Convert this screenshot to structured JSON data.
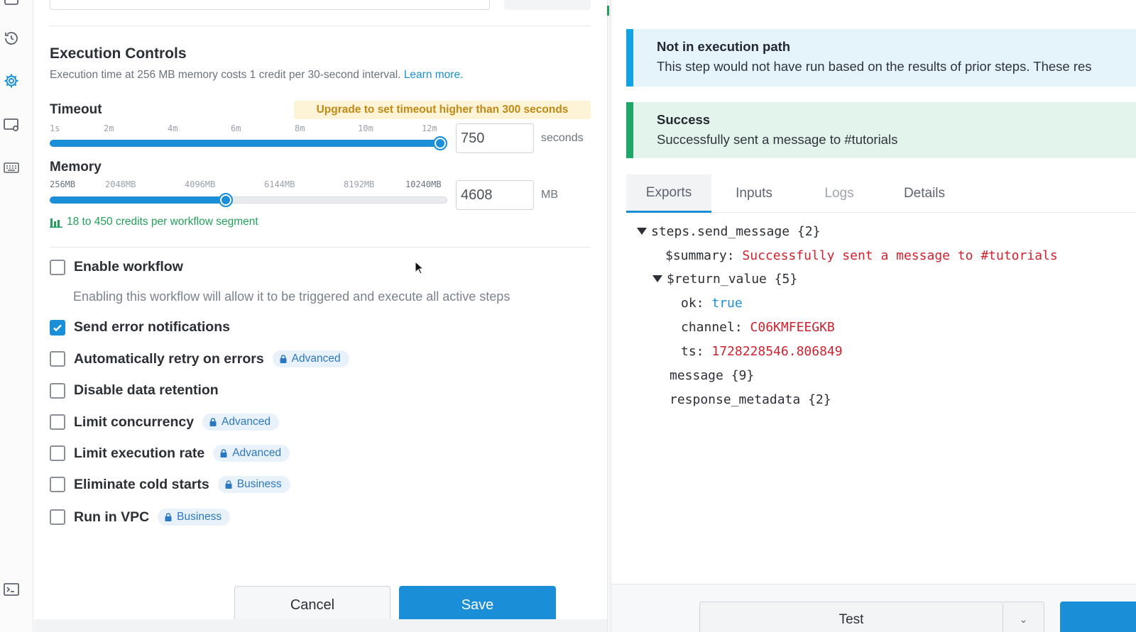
{
  "settings": {
    "section_title": "Execution Controls",
    "section_desc": "Execution time at 256 MB memory costs 1 credit per 30-second interval.",
    "learn_more": "Learn more.",
    "timeout": {
      "label": "Timeout",
      "upgrade_notice": "Upgrade to set timeout higher than 300 seconds",
      "ticks": [
        "1s",
        "2m",
        "4m",
        "6m",
        "8m",
        "10m",
        "12m"
      ],
      "value": "750",
      "unit": "seconds",
      "slider_fraction": 1.0
    },
    "memory": {
      "label": "Memory",
      "ticks": [
        "256MB",
        "2048MB",
        "4096MB",
        "6144MB",
        "8192MB",
        "10240MB"
      ],
      "value": "4608",
      "unit": "MB",
      "slider_fraction": 0.44
    },
    "credits_note": "18 to 450 credits per workflow segment",
    "options": [
      {
        "label": "Enable workflow",
        "checked": false,
        "badge": ""
      },
      {
        "label": "Send error notifications",
        "checked": true,
        "badge": ""
      },
      {
        "label": "Automatically retry on errors",
        "checked": false,
        "badge": "Advanced"
      },
      {
        "label": "Disable data retention",
        "checked": false,
        "badge": ""
      },
      {
        "label": "Limit concurrency",
        "checked": false,
        "badge": "Advanced"
      },
      {
        "label": "Limit execution rate",
        "checked": false,
        "badge": "Advanced"
      },
      {
        "label": "Eliminate cold starts",
        "checked": false,
        "badge": "Business"
      },
      {
        "label": "Run in VPC",
        "checked": false,
        "badge": "Business"
      }
    ],
    "enable_help": "Enabling this workflow will allow it to be triggered and execute all active steps",
    "cancel_label": "Cancel",
    "save_label": "Save"
  },
  "results": {
    "info_alert": {
      "title": "Not in execution path",
      "body": "This step would not have run based on the results of prior steps. These res"
    },
    "success_alert": {
      "title": "Success",
      "body": "Successfully sent a message to #tutorials"
    },
    "tabs": [
      "Exports",
      "Inputs",
      "Logs",
      "Details"
    ],
    "tree": {
      "root": "steps.send_message {2}",
      "summary_key": "$summary:",
      "summary_val": "Successfully sent a message to #tutorials",
      "return_value": "$return_value {5}",
      "ok_key": "ok:",
      "ok_val": "true",
      "channel_key": "channel:",
      "channel_val": "C06KMFEEGKB",
      "ts_key": "ts:",
      "ts_val": "1728228546.806849",
      "message": "message {9}",
      "response_metadata": "response_metadata {2}"
    },
    "test_label": "Test"
  },
  "colors": {
    "accent": "#1a8fd7",
    "success": "#1ea766",
    "info": "#13a2e3",
    "warning_bg": "#fdf3d6",
    "warning_text": "#c28a14",
    "string_value": "#d0222e"
  },
  "icons": [
    "history-icon",
    "gear-icon",
    "settings-window-icon",
    "keyboard-icon",
    "terminal-icon",
    "lock-icon",
    "bar-chart-icon"
  ]
}
